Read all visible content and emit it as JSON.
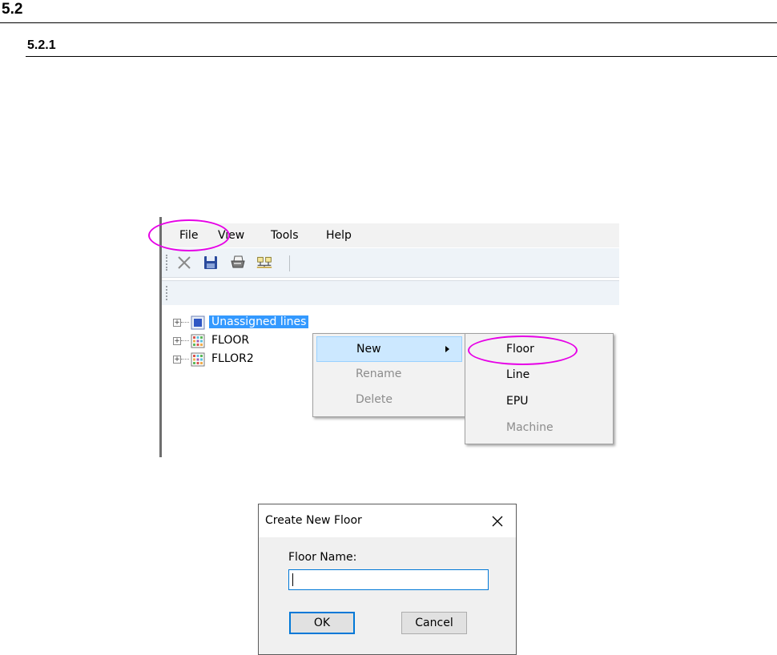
{
  "doc": {
    "heading1": "5.2",
    "heading2": "5.2.1"
  },
  "app": {
    "menubar": [
      "File",
      "View",
      "Tools",
      "Help"
    ],
    "tree": [
      {
        "label": "Unassigned lines",
        "selected": true
      },
      {
        "label": "FLOOR",
        "selected": false
      },
      {
        "label": "FLLOR2",
        "selected": false
      }
    ],
    "context_menu": [
      {
        "label": "New",
        "enabled": true,
        "has_submenu": true
      },
      {
        "label": "Rename",
        "enabled": false
      },
      {
        "label": "Delete",
        "enabled": false
      }
    ],
    "submenu": [
      {
        "label": "Floor",
        "enabled": true
      },
      {
        "label": "Line",
        "enabled": true
      },
      {
        "label": "EPU",
        "enabled": true
      },
      {
        "label": "Machine",
        "enabled": false
      }
    ],
    "toolbar_icons": [
      "delete-icon",
      "save-icon",
      "print-icon",
      "network-icon"
    ],
    "highlight_color": "#e600e6",
    "selection_color": "#3399ff"
  },
  "dialog": {
    "title": "Create New Floor",
    "field_label": "Floor Name:",
    "field_value": "",
    "ok_label": "OK",
    "cancel_label": "Cancel"
  }
}
